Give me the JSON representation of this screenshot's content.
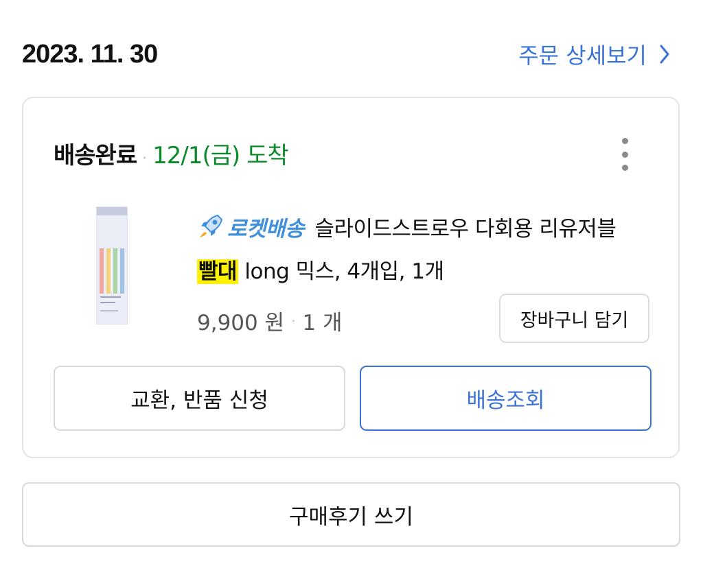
{
  "order": {
    "date": "2023. 11. 30",
    "detail_link_label": "주문 상세보기",
    "detail_link_icon": "chevron-right-icon"
  },
  "card": {
    "status": "배송완료",
    "status_separator": "·",
    "arrival": "12/1(금) 도착",
    "more_icon": "more-vertical-icon",
    "product": {
      "badge_icon": "rocket-icon",
      "badge_label": "로켓배송",
      "title_part1": "슬라이드스트로우 다회용 리유저블",
      "highlight_word": "빨대",
      "title_part2": "long 믹스, 4개입, 1개",
      "price": "9,900 원",
      "quantity_separator": "·",
      "quantity": "1 개",
      "cart_button_label": "장바구니 담기"
    },
    "exchange_button_label": "교환, 반품 신청",
    "tracking_button_label": "배송조회"
  },
  "review_button_label": "구매후기 쓰기",
  "colors": {
    "link_blue": "#3a72d8",
    "arrival_green": "#0a8a2a",
    "rocket_blue": "#3f8fdb",
    "highlight_yellow": "#fff200"
  }
}
